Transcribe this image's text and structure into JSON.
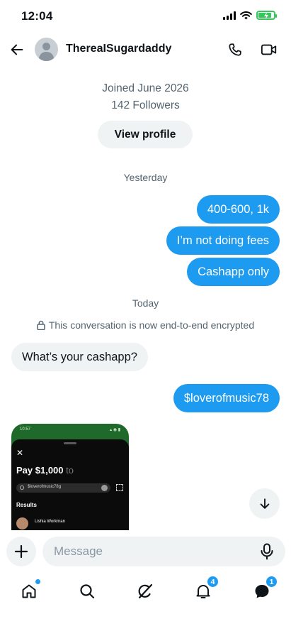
{
  "status_bar": {
    "time": "12:04"
  },
  "header": {
    "username": "ThereaISugardaddy"
  },
  "profile": {
    "joined": "Joined June 2026",
    "followers": "142 Followers",
    "view_profile_label": "View profile"
  },
  "conversation": {
    "yesterday_label": "Yesterday",
    "today_label": "Today",
    "encrypted_notice": "This conversation is now end-to-end encrypted",
    "messages": [
      {
        "direction": "outgoing",
        "text": "400-600, 1k"
      },
      {
        "direction": "outgoing",
        "text": "I’m not doing fees"
      },
      {
        "direction": "outgoing",
        "text": "Cashapp only"
      },
      {
        "direction": "incoming",
        "text": "What’s your cashapp?"
      },
      {
        "direction": "outgoing",
        "text": "$loverofmusic78"
      }
    ],
    "attachment": {
      "status_time": "10:57",
      "pay_amount": "Pay $1,000",
      "pay_to": "to",
      "search_value": "$loverofmusic78g",
      "results_label": "Results",
      "result_name": "Lishia Workman"
    }
  },
  "composer": {
    "placeholder": "Message"
  },
  "bottom_nav": {
    "items": [
      {
        "name": "home",
        "icon": "home-icon",
        "dot": true
      },
      {
        "name": "search",
        "icon": "search-icon"
      },
      {
        "name": "grok",
        "icon": "grok-icon"
      },
      {
        "name": "notifications",
        "icon": "bell-icon",
        "badge": "4"
      },
      {
        "name": "messages",
        "icon": "messages-icon",
        "badge": "1"
      }
    ]
  },
  "colors": {
    "accent": "#1d9bf0",
    "bubble_incoming": "#eff3f4",
    "muted_text": "#536471"
  }
}
